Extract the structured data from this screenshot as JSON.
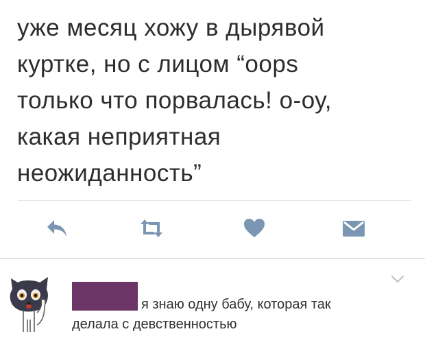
{
  "tweet": {
    "lines": [
      "уже месяц хожу в дырявой",
      "куртке, но с лицом “oops",
      "только что порвалась! о-оу,",
      "какая неприятная",
      "неожиданность”"
    ]
  },
  "actions": [
    {
      "icon": "reply-icon",
      "color": "#7a96b3"
    },
    {
      "icon": "retweet-icon",
      "color": "#7a96b3"
    },
    {
      "icon": "heart-icon",
      "color": "#7a96b3"
    },
    {
      "icon": "direct-message-icon",
      "color": "#7a96b3"
    }
  ],
  "reply": {
    "avatar_icon": "cat-avatar-icon",
    "username_redaction_color": "#6b3565",
    "text_line1": "я знаю одну бабу, которая так",
    "text_line2": "делала с девственностью",
    "menu_icon": "chevron-down-icon"
  }
}
